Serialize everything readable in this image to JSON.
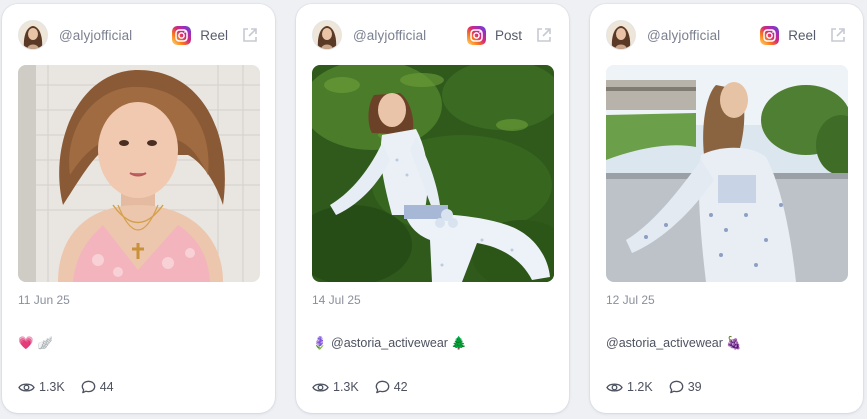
{
  "colors": {
    "card_bg": "#ffffff",
    "page_bg": "#eef0f4",
    "muted_text": "#8a8f9c",
    "icon_gray": "#4d5260"
  },
  "cards": [
    {
      "handle": "@alyjofficial",
      "platform_icon": "instagram-icon",
      "type": "Reel",
      "date": "11 Jun 25",
      "caption": "💗 🪽",
      "views": "1.3K",
      "comments": "44"
    },
    {
      "handle": "@alyjofficial",
      "platform_icon": "instagram-icon",
      "type": "Post",
      "date": "14 Jul 25",
      "caption": "🪻 @astoria_activewear 🌲",
      "views": "1.3K",
      "comments": "42"
    },
    {
      "handle": "@alyjofficial",
      "platform_icon": "instagram-icon",
      "type": "Reel",
      "date": "12 Jul 25",
      "caption": "@astoria_activewear 🍇",
      "views": "1.2K",
      "comments": "39"
    }
  ]
}
